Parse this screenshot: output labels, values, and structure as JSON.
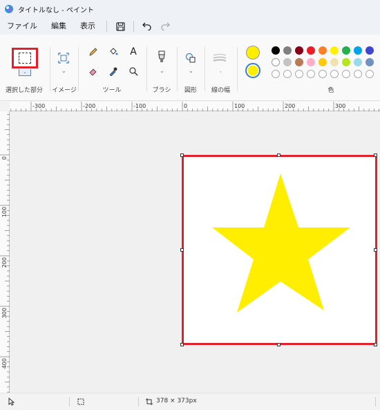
{
  "window": {
    "title": "タイトルなし - ペイント"
  },
  "menu": {
    "file": "ファイル",
    "edit": "編集",
    "view": "表示"
  },
  "ribbon": {
    "groups": {
      "selection": "選択した部分",
      "image": "イメージ",
      "tools": "ツール",
      "brush": "ブラシ",
      "shapes": "図形",
      "line_width": "線の幅",
      "colors": "色"
    },
    "color1": "#ffee00",
    "color2": "#ffee00",
    "palette_row1": [
      "#000000",
      "#7f7f7f",
      "#880015",
      "#ed1c24",
      "#ff7f27",
      "#fff200",
      "#22b14c",
      "#00a2e8",
      "#3f48cc"
    ],
    "palette_row2": [
      "#ffffff",
      "#c3c3c3",
      "#b97a57",
      "#ffaec9",
      "#ffc90e",
      "#efe4b0",
      "#b5e61d",
      "#99d9ea",
      "#7092be"
    ]
  },
  "ruler": {
    "top_labels": [
      "-300",
      "-200",
      "-100",
      "0",
      "100",
      "200",
      "300"
    ],
    "left_labels": [
      "0",
      "100",
      "200",
      "300",
      "400"
    ]
  },
  "canvas": {
    "background": "#ffffff",
    "star_color": "#ffee00",
    "selection_color": "#e0202a"
  },
  "status": {
    "dimensions": "378 × 373px"
  }
}
